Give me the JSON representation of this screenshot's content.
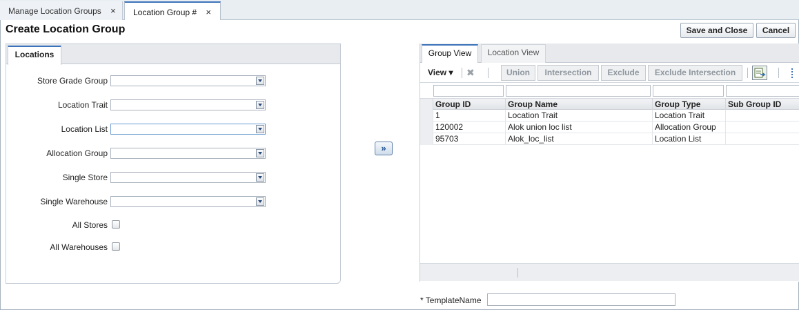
{
  "doc_tabs": [
    {
      "label": "Manage Location Groups",
      "active": false
    },
    {
      "label": "Location Group #",
      "active": true
    }
  ],
  "close_glyph": "×",
  "page_title": "Create Location Group",
  "actions": {
    "save_close": "Save and Close",
    "cancel": "Cancel"
  },
  "left_panel": {
    "tab": "Locations",
    "fields": [
      {
        "label": "Store Grade Group",
        "value": ""
      },
      {
        "label": "Location Trait",
        "value": ""
      },
      {
        "label": "Location List",
        "value": ""
      },
      {
        "label": "Allocation Group",
        "value": ""
      },
      {
        "label": "Single Store",
        "value": ""
      },
      {
        "label": "Single Warehouse",
        "value": ""
      }
    ],
    "checkboxes": [
      {
        "label": "All Stores",
        "checked": false
      },
      {
        "label": "All Warehouses",
        "checked": false
      }
    ]
  },
  "shuttle_glyph": "»",
  "right_panel": {
    "tabs": [
      {
        "label": "Group View",
        "active": true
      },
      {
        "label": "Location View",
        "active": false
      }
    ],
    "toolbar": {
      "view_menu": "View ▾",
      "delete_icon": "✖",
      "buttons": [
        "Union",
        "Intersection",
        "Exclude",
        "Exclude Intersection"
      ]
    },
    "grid": {
      "columns": [
        "Group ID",
        "Group Name",
        "Group Type",
        "Sub Group ID"
      ],
      "rows": [
        [
          "1",
          "Location Trait",
          "Location Trait",
          ""
        ],
        [
          "120002",
          "Alok union loc list",
          "Allocation Group",
          ""
        ],
        [
          "95703",
          "Alok_loc_list",
          "Location List",
          ""
        ]
      ]
    }
  },
  "template": {
    "required_mark": "*",
    "label": "TemplateName",
    "value": ""
  },
  "colors": {
    "accent": "#3b73b9",
    "tab_strip": "#e9eef3",
    "panel_header": "#e7e9ec"
  }
}
